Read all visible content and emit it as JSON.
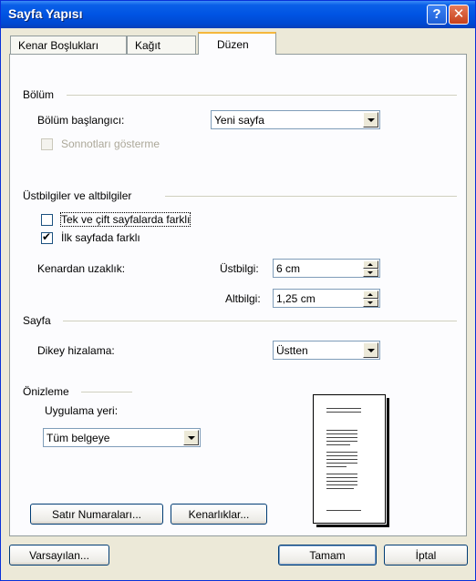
{
  "window": {
    "title": "Sayfa Yapısı",
    "help_glyph": "?",
    "close_glyph": "✕"
  },
  "tabs": [
    {
      "label": "Kenar Boşlukları"
    },
    {
      "label": "Kağıt"
    },
    {
      "label": "Düzen"
    }
  ],
  "section_bolum": {
    "heading": "Bölüm",
    "start_label": "Bölüm başlangıcı:",
    "start_value": "Yeni sayfa",
    "endnotes_label": "Sonnotları gösterme",
    "endnotes_checked": false
  },
  "section_headers": {
    "heading": "Üstbilgiler ve altbilgiler",
    "odd_even_label": "Tek ve çift sayfalarda farklı",
    "odd_even_checked": false,
    "first_page_label": "İlk sayfada farklı",
    "first_page_checked": true,
    "from_edge_label": "Kenardan uzaklık:",
    "header_label": "Üstbilgi:",
    "header_value": "6 cm",
    "footer_label": "Altbilgi:",
    "footer_value": "1,25 cm"
  },
  "section_page": {
    "heading": "Sayfa",
    "vertical_align_label": "Dikey hizalama:",
    "vertical_align_value": "Üstten"
  },
  "section_preview": {
    "heading": "Önizleme",
    "apply_to_label": "Uygulama yeri:",
    "apply_to_value": "Tüm belgeye"
  },
  "buttons": {
    "line_numbers": "Satır Numaraları...",
    "borders": "Kenarlıklar...",
    "default": "Varsayılan...",
    "ok": "Tamam",
    "cancel": "İptal"
  }
}
